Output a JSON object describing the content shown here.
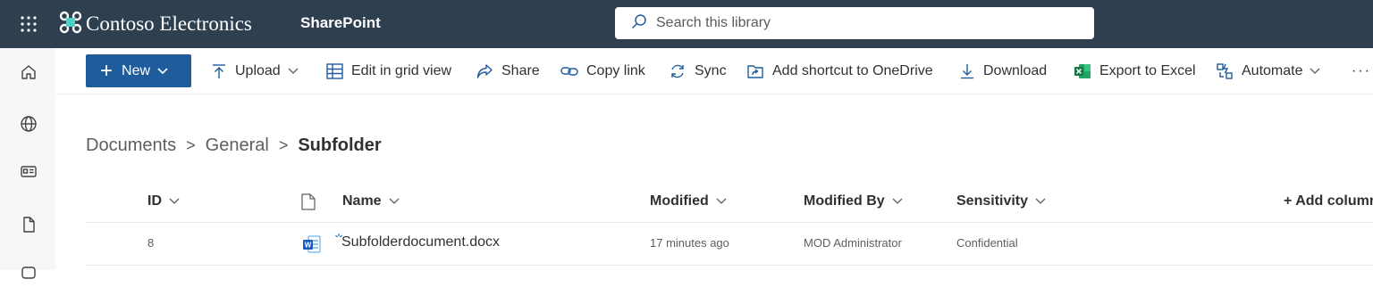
{
  "suite_bar": {
    "brand": "Contoso Electronics",
    "app_name": "SharePoint",
    "search_placeholder": "Search this library",
    "bg_color": "#2e3f50"
  },
  "left_rail": {
    "items": [
      "home-icon",
      "globe-icon",
      "news-icon",
      "document-icon",
      "chat-icon"
    ]
  },
  "command_bar": {
    "new_label": "New",
    "upload_label": "Upload",
    "grid_label": "Edit in grid view",
    "share_label": "Share",
    "copy_link_label": "Copy link",
    "sync_label": "Sync",
    "shortcut_label": "Add shortcut to OneDrive",
    "download_label": "Download",
    "export_label": "Export to Excel",
    "automate_label": "Automate",
    "more_label": "···",
    "accent_color": "#1f5c9c"
  },
  "breadcrumb": {
    "items": [
      "Documents",
      "General"
    ],
    "current": "Subfolder",
    "separator": ">"
  },
  "columns": {
    "id": "ID",
    "name": "Name",
    "modified": "Modified",
    "modified_by": "Modified By",
    "sensitivity": "Sensitivity",
    "add_column": "+ Add column"
  },
  "rows": [
    {
      "id": "8",
      "name": "Subfolderdocument.docx",
      "modified": "17 minutes ago",
      "modified_by": "MOD Administrator",
      "sensitivity": "Confidential",
      "file_icon": "word-doc-icon"
    }
  ]
}
